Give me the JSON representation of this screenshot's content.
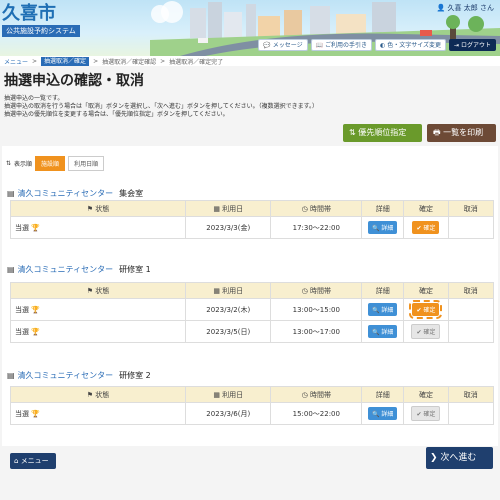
{
  "header": {
    "city": "久喜市",
    "system_name": "公共施設予約システム",
    "user": "久喜 太郎 さん",
    "buttons": {
      "message": "メッセージ",
      "guide": "ご利用の手引き",
      "color": "色・文字サイズ変更",
      "logout": "ログアウト"
    }
  },
  "breadcrumb": {
    "menu": "メニュー",
    "sep": ">",
    "current": "抽選取消／確定",
    "step2": "抽選取消／確定確認",
    "step3": "抽選取消／確定完了"
  },
  "page": {
    "title": "抽選申込の確認・取消",
    "desc1": "抽選申込の一覧です。",
    "desc2": "抽選申込の取消を行う場合は「取消」ボタンを選択し、「次へ進む」ボタンを押してください。（複数選択できます。）",
    "desc3": "抽選申込の優先順位を変更する場合は、「優先順位指定」ボタンを押してください。"
  },
  "actions": {
    "priority": "優先順位指定",
    "print": "一覧を印刷"
  },
  "sort": {
    "label": "表示順",
    "options": [
      "施設順",
      "利用日順"
    ]
  },
  "table_headers": {
    "status": "状態",
    "date": "利用日",
    "time": "時間帯",
    "detail": "詳細",
    "confirm": "確定",
    "cancel": "取消"
  },
  "groups": [
    {
      "facility": "清久コミュニティセンター",
      "room": "集会室",
      "rows": [
        {
          "status": "当選",
          "date": "2023/3/3(金)",
          "time": "17:30～22:00",
          "detail": "詳細",
          "confirm": "確定"
        }
      ]
    },
    {
      "facility": "清久コミュニティセンター",
      "room": "研修室 1",
      "rows": [
        {
          "status": "当選",
          "date": "2023/3/2(木)",
          "time": "13:00～15:00",
          "detail": "詳細",
          "confirm": "確定"
        },
        {
          "status": "当選",
          "date": "2023/3/5(日)",
          "time": "13:00～17:00",
          "detail": "詳細",
          "confirm": "確定"
        }
      ]
    },
    {
      "facility": "清久コミュニティセンター",
      "room": "研修室 2",
      "rows": [
        {
          "status": "当選",
          "date": "2023/3/6(月)",
          "time": "15:00～22:00",
          "detail": "詳細",
          "confirm": "確定"
        }
      ]
    }
  ],
  "footer": {
    "menu": "メニュー",
    "next": "次へ進む"
  },
  "colors": {
    "primary": "#2a6cb6",
    "orange": "#f0921e",
    "green": "#6a9a2b",
    "brown": "#6d4a36",
    "navy": "#1f3f6e",
    "table_header": "#f8efcf"
  }
}
